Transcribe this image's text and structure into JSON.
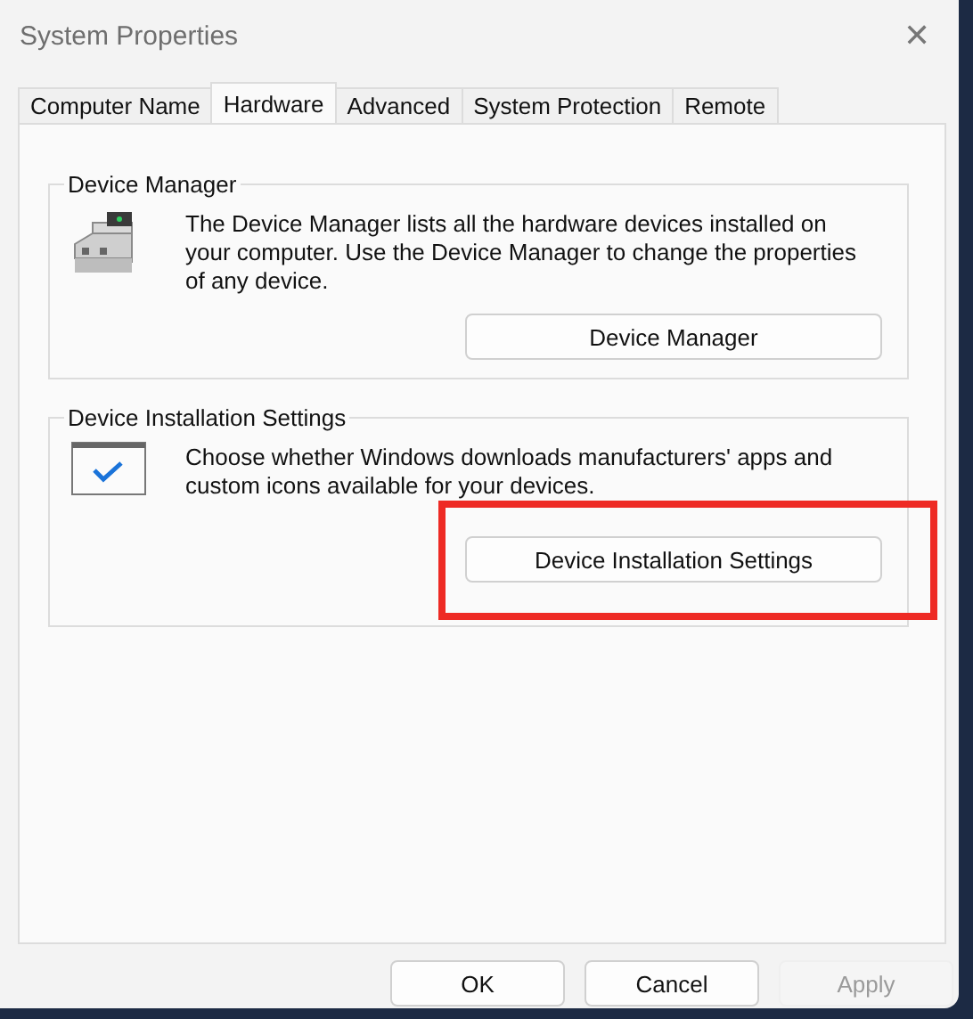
{
  "window": {
    "title": "System Properties",
    "close": "✕"
  },
  "tabs": [
    {
      "label": "Computer Name",
      "selected": false
    },
    {
      "label": "Hardware",
      "selected": true
    },
    {
      "label": "Advanced",
      "selected": false
    },
    {
      "label": "System Protection",
      "selected": false
    },
    {
      "label": "Remote",
      "selected": false
    }
  ],
  "groups": [
    {
      "kind": "device-manager",
      "title": "Device Manager",
      "text": "The Device Manager lists all the hardware devices installed on your computer. Use the Device Manager to change the properties of any device.",
      "button": {
        "label": "Device Manager",
        "highlighted": false
      }
    },
    {
      "kind": "installation",
      "title": "Device Installation Settings",
      "text": "Choose whether Windows downloads manufacturers' apps and custom icons available for your devices.",
      "button": {
        "label": "Device Installation Settings",
        "highlighted": true
      }
    }
  ],
  "buttons": [
    {
      "label": "OK",
      "disabled": false
    },
    {
      "label": "Cancel",
      "disabled": false
    },
    {
      "label": "Apply",
      "disabled": true
    }
  ]
}
